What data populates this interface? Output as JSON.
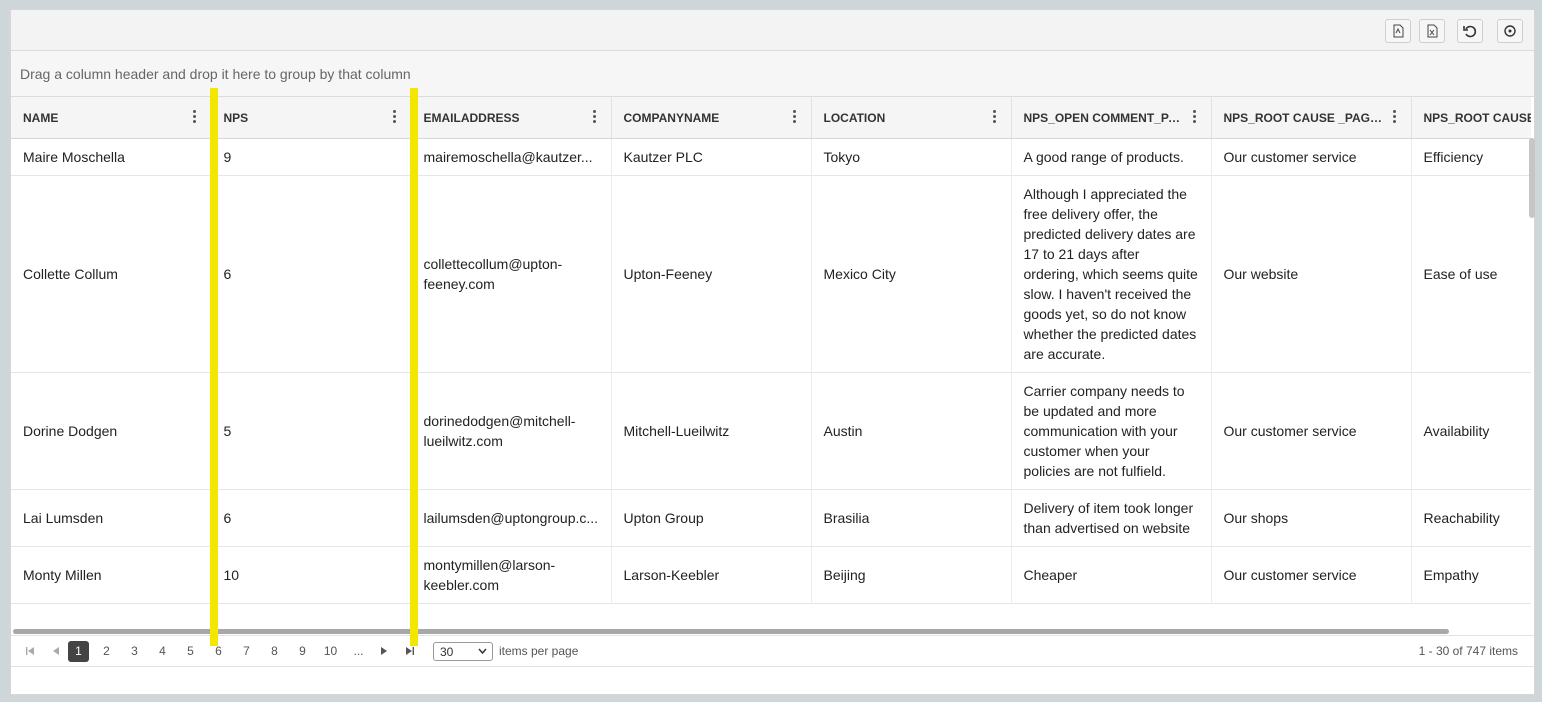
{
  "toolbar": {
    "buttons": [
      {
        "name": "pdf-export-icon"
      },
      {
        "name": "excel-export-icon"
      },
      {
        "name": "undo-icon"
      },
      {
        "name": "refresh-icon"
      }
    ]
  },
  "group_bar": {
    "text": "Drag a column header and drop it here to group by that column"
  },
  "columns": [
    {
      "key": "name",
      "label": "NAME"
    },
    {
      "key": "nps",
      "label": "NPS"
    },
    {
      "key": "email",
      "label": "EMAILADDRESS"
    },
    {
      "key": "company",
      "label": "COMPANYNAME"
    },
    {
      "key": "location",
      "label": "LOCATION"
    },
    {
      "key": "comment",
      "label": "NPS_OPEN COMMENT_PA..."
    },
    {
      "key": "root1",
      "label": "NPS_ROOT CAUSE _PAGE7..."
    },
    {
      "key": "root2",
      "label": "NPS_ROOT CAUSE"
    }
  ],
  "rows": [
    {
      "name": "Maire Moschella",
      "nps": "9",
      "email": "mairemoschella@kautzer...",
      "company": "Kautzer PLC",
      "location": "Tokyo",
      "comment": "A good range of products.",
      "root1": "Our customer service",
      "root2": "Efficiency"
    },
    {
      "name": "Collette Collum",
      "nps": "6",
      "email": "collettecollum@upton-feeney.com",
      "company": "Upton-Feeney",
      "location": "Mexico City",
      "comment": "Although I appreciated the free delivery offer, the predicted delivery dates are 17 to 21 days after ordering, which seems quite slow.  I haven't received the goods yet, so do not know whether the predicted dates are accurate.",
      "root1": "Our website",
      "root2": "Ease of use"
    },
    {
      "name": "Dorine Dodgen",
      "nps": "5",
      "email": "dorinedodgen@mitchell-lueilwitz.com",
      "company": "Mitchell-Lueilwitz",
      "location": "Austin",
      "comment": "Carrier company needs to be updated and more communication with your customer when your policies are not fulfield.",
      "root1": "Our customer service",
      "root2": "Availability"
    },
    {
      "name": "Lai Lumsden",
      "nps": "6",
      "email": "lailumsden@uptongroup.c...",
      "company": "Upton Group",
      "location": "Brasilia",
      "comment": "Delivery of item took longer than advertised on website",
      "root1": "Our shops",
      "root2": "Reachability"
    },
    {
      "name": "Monty Millen",
      "nps": "10",
      "email": "montymillen@larson-keebler.com",
      "company": "Larson-Keebler",
      "location": "Beijing",
      "comment": "Cheaper",
      "root1": "Our customer service",
      "root2": "Empathy"
    }
  ],
  "pager": {
    "pages": [
      "1",
      "2",
      "3",
      "4",
      "5",
      "6",
      "7",
      "8",
      "9",
      "10",
      "..."
    ],
    "current": "1",
    "page_size": "30",
    "items_per_page_label": "items per page",
    "info": "1 - 30 of 747 items"
  }
}
